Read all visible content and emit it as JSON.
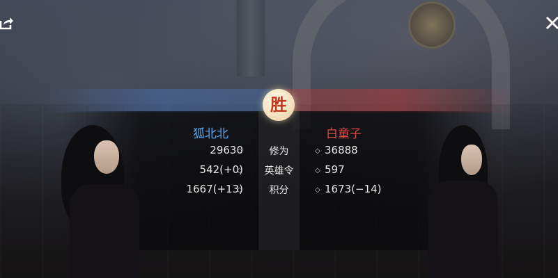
{
  "header": {
    "share_icon": "share-icon",
    "close_icon": "close-icon"
  },
  "result": {
    "badge": "胜"
  },
  "players": {
    "left": {
      "name": "狐北北",
      "color": "#5aa8f0",
      "stats": [
        "29630",
        "542(+0)",
        "1667(+13)"
      ]
    },
    "right": {
      "name": "白童子",
      "color": "#e04848",
      "stats": [
        "36888",
        "597",
        "1673(−14)"
      ]
    }
  },
  "stat_labels": [
    "修为",
    "英雄令",
    "积分"
  ],
  "diamond_glyph": "◇"
}
